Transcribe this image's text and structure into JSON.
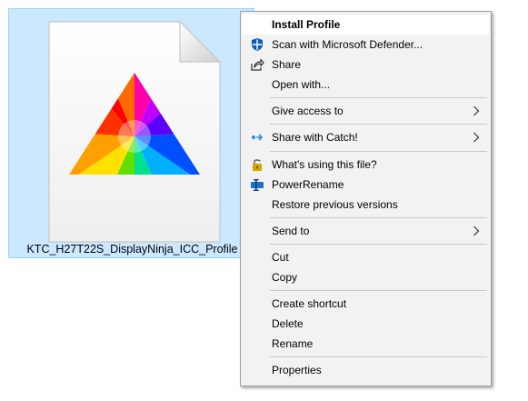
{
  "file": {
    "name": "KTC_H27T22S_DisplayNinja_ICC_Profile"
  },
  "menu": {
    "items": [
      {
        "label": "Install Profile",
        "icon": "none",
        "submenu": false,
        "default": true
      },
      {
        "label": "Scan with Microsoft Defender...",
        "icon": "defender-icon",
        "submenu": false
      },
      {
        "label": "Share",
        "icon": "share-icon",
        "submenu": false
      },
      {
        "label": "Open with...",
        "icon": "none",
        "submenu": false
      },
      {
        "label": "Give access to",
        "icon": "none",
        "submenu": true
      },
      {
        "label": "Share with Catch!",
        "icon": "catch-icon",
        "submenu": true
      },
      {
        "label": "What's using this file?",
        "icon": "lock-icon",
        "submenu": false
      },
      {
        "label": "PowerRename",
        "icon": "powerrename-icon",
        "submenu": false
      },
      {
        "label": "Restore previous versions",
        "icon": "none",
        "submenu": false
      },
      {
        "label": "Send to",
        "icon": "none",
        "submenu": true
      },
      {
        "label": "Cut",
        "icon": "none",
        "submenu": false
      },
      {
        "label": "Copy",
        "icon": "none",
        "submenu": false
      },
      {
        "label": "Create shortcut",
        "icon": "none",
        "submenu": false
      },
      {
        "label": "Delete",
        "icon": "none",
        "submenu": false
      },
      {
        "label": "Rename",
        "icon": "none",
        "submenu": false
      },
      {
        "label": "Properties",
        "icon": "none",
        "submenu": false
      }
    ]
  },
  "colors": {
    "selection_bg": "#cce8ff",
    "selection_border": "#99d1ff",
    "menu_bg": "#f2f2f2",
    "defender_blue": "#0a5fb4",
    "catch_blue": "#2a8dd4"
  }
}
